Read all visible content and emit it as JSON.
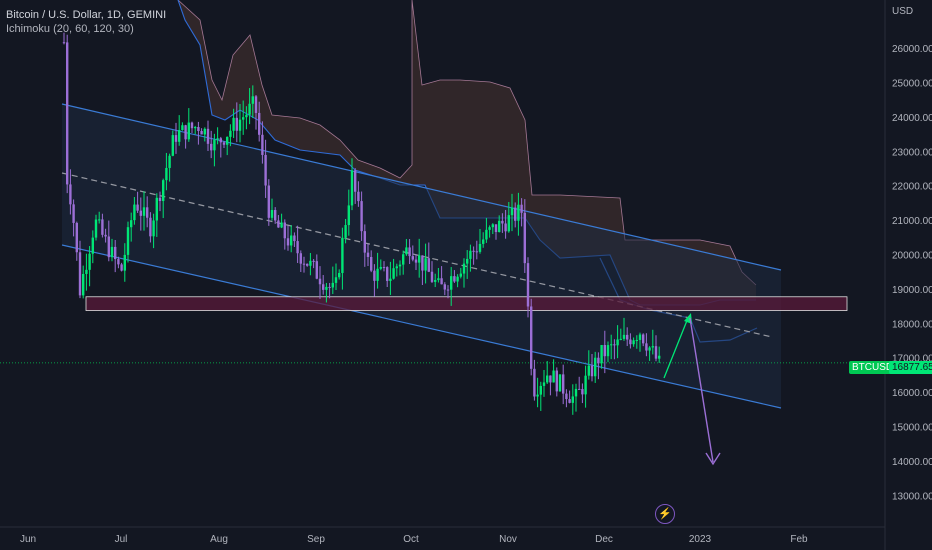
{
  "header": {
    "title": "Bitcoin / U.S. Dollar, 1D, GEMINI",
    "indicator": "Ichimoku (20, 60, 120, 30)"
  },
  "axis": {
    "currency": "USD",
    "y_ticks": [
      "26000.00",
      "25000.00",
      "24000.00",
      "23000.00",
      "22000.00",
      "21000.00",
      "20000.00",
      "19000.00",
      "18000.00",
      "17000.00",
      "16000.00",
      "15000.00",
      "14000.00",
      "13000.00"
    ],
    "x_ticks": [
      "Jun",
      "Jul",
      "Aug",
      "Sep",
      "Oct",
      "Nov",
      "Dec",
      "2023",
      "Feb"
    ]
  },
  "price_tag": {
    "symbol": "BTCUSD",
    "price": "16877.65",
    "countdown": "—"
  },
  "colors": {
    "background": "#131722",
    "up": "#00e676",
    "down": "#9c6fd6",
    "channel": "#2962ff",
    "cloud": "#3b2c2c",
    "kijun": "#2f6bd6",
    "zone_fill": "#5a1a3a",
    "zone_border": "#e0e0e0",
    "projection_up": "#00e676",
    "projection_down": "#9c6fd6"
  },
  "chart_data": {
    "type": "candlestick",
    "title": "Bitcoin / U.S. Dollar, 1D, GEMINI",
    "ylim": [
      12000,
      27000
    ],
    "x_categories": [
      "Jun",
      "Jul",
      "Aug",
      "Sep",
      "Oct",
      "Nov",
      "Dec",
      "2023",
      "Feb"
    ],
    "series": [
      {
        "name": "BTCUSD",
        "close_path": [
          {
            "x": "Jun 10",
            "y": 30000
          },
          {
            "x": "Jun 13",
            "y": 22400
          },
          {
            "x": "Jun 15",
            "y": 21500
          },
          {
            "x": "Jun 18",
            "y": 19000
          },
          {
            "x": "Jun 25",
            "y": 21000
          },
          {
            "x": "Jul 1",
            "y": 19500
          },
          {
            "x": "Jul 8",
            "y": 21600
          },
          {
            "x": "Jul 15",
            "y": 20800
          },
          {
            "x": "Jul 20",
            "y": 23500
          },
          {
            "x": "Jul 28",
            "y": 23800
          },
          {
            "x": "Aug 5",
            "y": 23200
          },
          {
            "x": "Aug 14",
            "y": 24400
          },
          {
            "x": "Aug 19",
            "y": 21100
          },
          {
            "x": "Aug 26",
            "y": 20200
          },
          {
            "x": "Sep 6",
            "y": 18900
          },
          {
            "x": "Sep 12",
            "y": 22300
          },
          {
            "x": "Sep 19",
            "y": 19500
          },
          {
            "x": "Sep 28",
            "y": 19400
          },
          {
            "x": "Oct 5",
            "y": 20300
          },
          {
            "x": "Oct 13",
            "y": 19000
          },
          {
            "x": "Oct 26",
            "y": 20700
          },
          {
            "x": "Nov 5",
            "y": 21300
          },
          {
            "x": "Nov 9",
            "y": 16100
          },
          {
            "x": "Nov 14",
            "y": 16600
          },
          {
            "x": "Nov 21",
            "y": 15800
          },
          {
            "x": "Dec 1",
            "y": 17100
          },
          {
            "x": "Dec 14",
            "y": 17800
          },
          {
            "x": "Dec 20",
            "y": 16800
          }
        ]
      }
    ],
    "annotations": {
      "resistance_zone": [
        18400,
        18800
      ],
      "current_price": 16877.65,
      "projection": [
        {
          "x": "Dec 20",
          "y": 16500
        },
        {
          "x": "Dec 28",
          "y": 18200
        },
        {
          "x": "Jan 5",
          "y": 14000
        }
      ]
    }
  }
}
